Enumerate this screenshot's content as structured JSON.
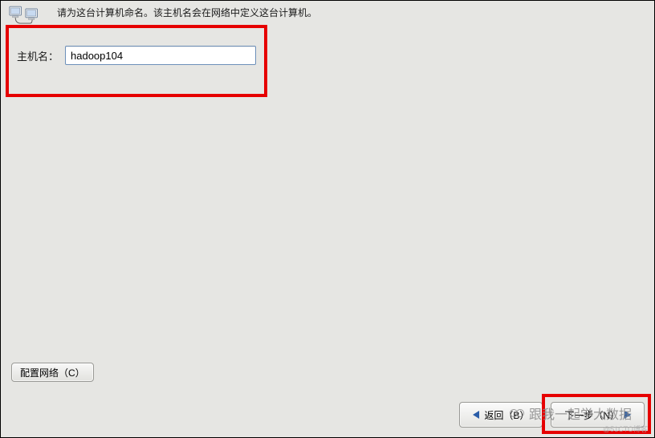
{
  "header": {
    "instruction": "请为这台计算机命名。该主机名会在网络中定义这台计算机。"
  },
  "hostname": {
    "label": "主机名：",
    "value": "hadoop104"
  },
  "configure_network": {
    "label": "配置网络（C）"
  },
  "nav": {
    "back_label": "返回（B）",
    "next_label": "下一步（N）"
  },
  "watermark": {
    "text": "跟我一起学大数据",
    "sub": "@51CTO博客"
  }
}
